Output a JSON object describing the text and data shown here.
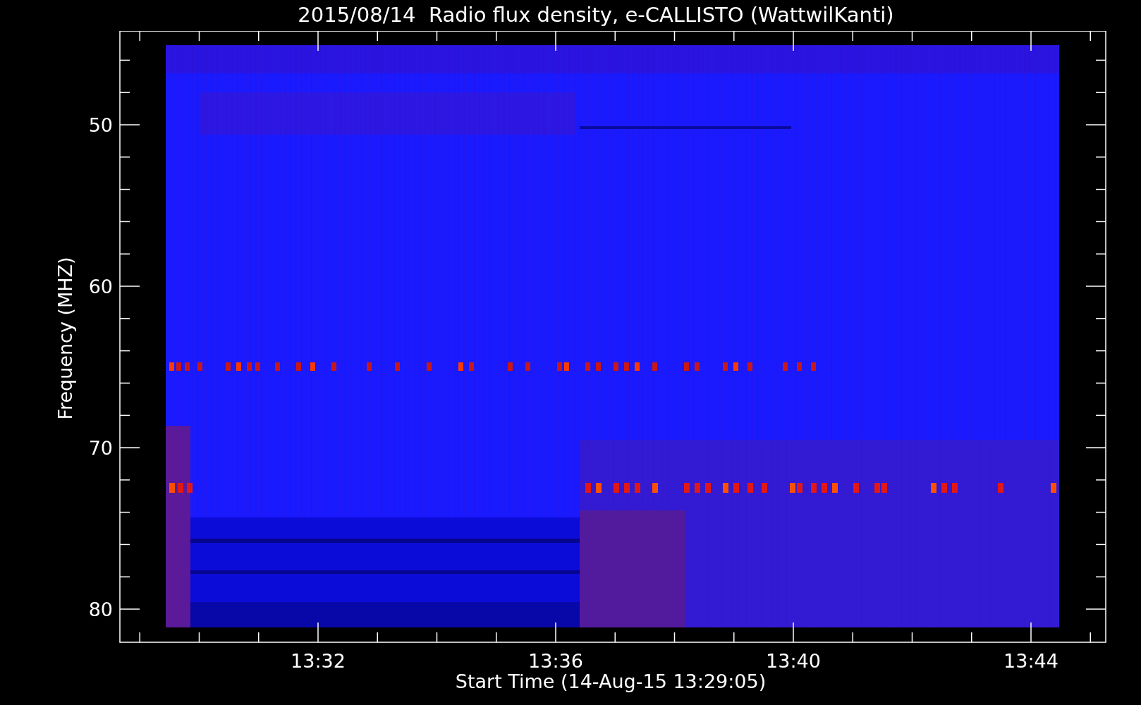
{
  "title": "2015/08/14  Radio flux density, e-CALLISTO (WattwilKanti)",
  "axes": {
    "ylabel": "Frequency (MHZ)",
    "xlabel": "Start Time (14-Aug-15 13:29:05)",
    "yticks": [
      "50",
      "60",
      "70",
      "80"
    ],
    "xticks": [
      "13:32",
      "13:36",
      "13:40",
      "13:44"
    ]
  }
}
